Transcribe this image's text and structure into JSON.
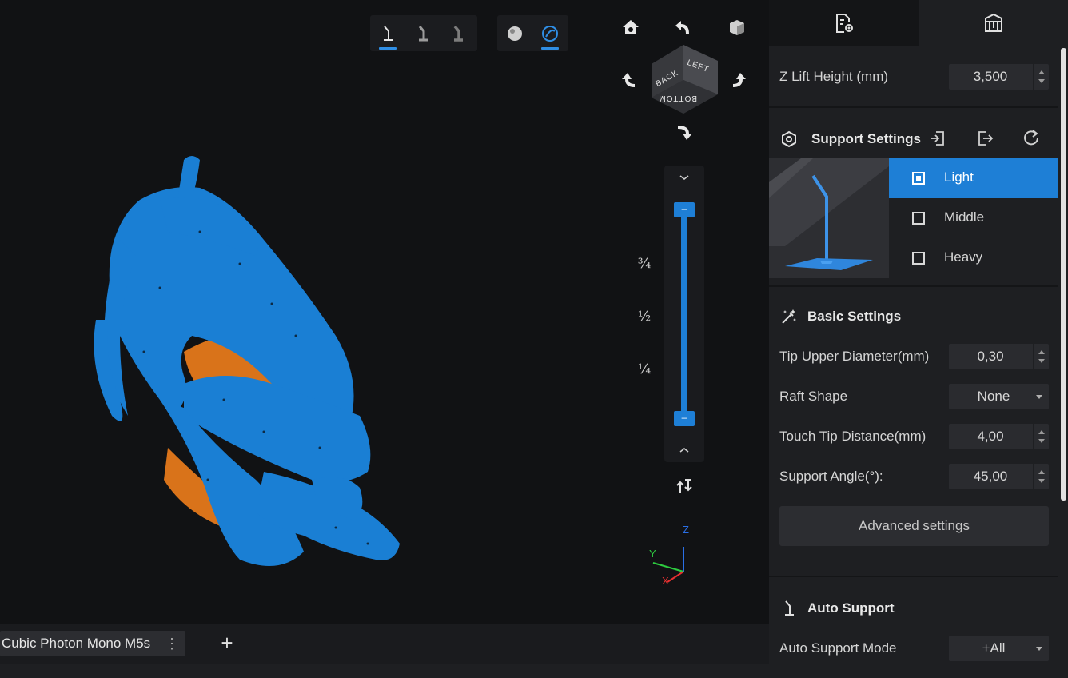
{
  "viewport": {
    "toolbar_support_modes": [
      "support-light-icon",
      "support-middle-icon",
      "support-heavy-icon"
    ],
    "toolbar_view_modes": [
      "solid-view-icon",
      "xray-view-icon"
    ],
    "view_cube": {
      "front": "LEFT",
      "side": "BACK",
      "bottom": "BOTTOM"
    },
    "slider": {
      "fractions": [
        "¾",
        "½",
        "¼"
      ],
      "handle_top_symbol": "–",
      "handle_bottom_symbol": "–"
    },
    "axes": {
      "x": "X",
      "y": "Y",
      "z": "Z"
    },
    "colors": {
      "model_blue": "#1a7fd4",
      "model_orange": "#d9731a",
      "accent": "#1e7fd6"
    }
  },
  "bottombar": {
    "printer_name": "Cubic Photon Mono M5s",
    "more_symbol": "⋮",
    "add_symbol": "+"
  },
  "panel": {
    "z_lift": {
      "label": "Z Lift Height (mm)",
      "value": "3,500"
    },
    "support_settings": {
      "title": "Support Settings",
      "presets": [
        {
          "label": "Light",
          "selected": true
        },
        {
          "label": "Middle",
          "selected": false
        },
        {
          "label": "Heavy",
          "selected": false
        }
      ]
    },
    "basic_settings": {
      "title": "Basic Settings",
      "tip_upper_diameter": {
        "label": "Tip Upper Diameter(mm)",
        "value": "0,30"
      },
      "raft_shape": {
        "label": "Raft Shape",
        "value": "None"
      },
      "touch_tip_distance": {
        "label": "Touch Tip Distance(mm)",
        "value": "4,00"
      },
      "support_angle": {
        "label": "Support Angle(°):",
        "value": "45,00"
      },
      "advanced_button": "Advanced settings"
    },
    "auto_support": {
      "title": "Auto Support",
      "mode": {
        "label": "Auto Support Mode",
        "value": "+All"
      }
    }
  }
}
